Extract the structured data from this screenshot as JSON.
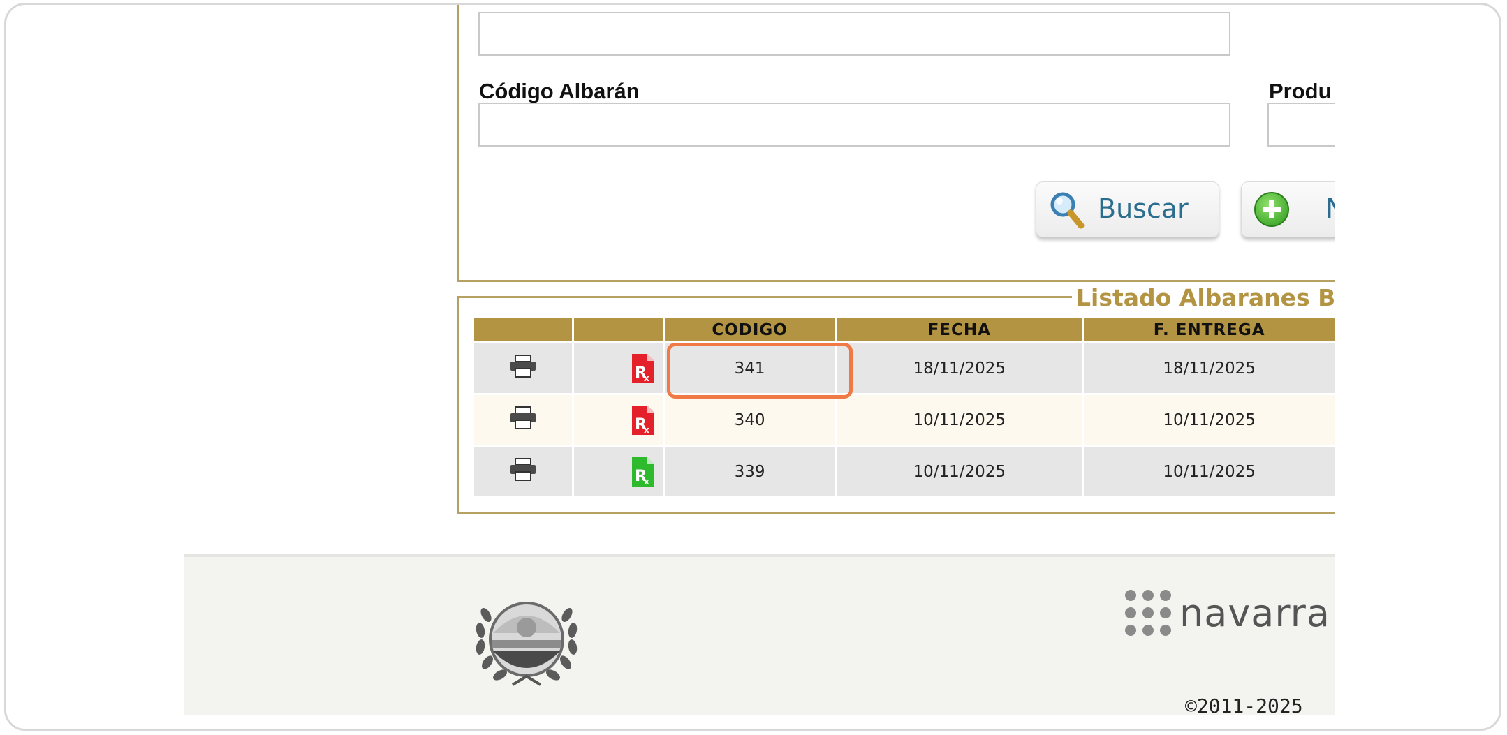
{
  "search": {
    "codigo_label": "Código Albarán",
    "codigo_value": "",
    "producto_label": "Produ",
    "producto_value": "",
    "buscar_label": "Buscar",
    "nuevo_label": "N"
  },
  "listing": {
    "legend": "Listado Albaranes B",
    "columns": [
      "",
      "",
      "CODIGO",
      "FECHA",
      "F. ENTREGA"
    ],
    "rows": [
      {
        "codigo": "341",
        "fecha": "18/11/2025",
        "entrega": "18/11/2025",
        "rx_color": "#e4212a"
      },
      {
        "codigo": "340",
        "fecha": "10/11/2025",
        "entrega": "10/11/2025",
        "rx_color": "#e4212a"
      },
      {
        "codigo": "339",
        "fecha": "10/11/2025",
        "entrega": "10/11/2025",
        "rx_color": "#2dbb2d"
      }
    ]
  },
  "footer": {
    "logo_text": "navarra",
    "copyright": "©2011-2025"
  },
  "colors": {
    "accent": "#b39443",
    "highlight": "#f07a45",
    "button_text": "#2a6d8e"
  }
}
